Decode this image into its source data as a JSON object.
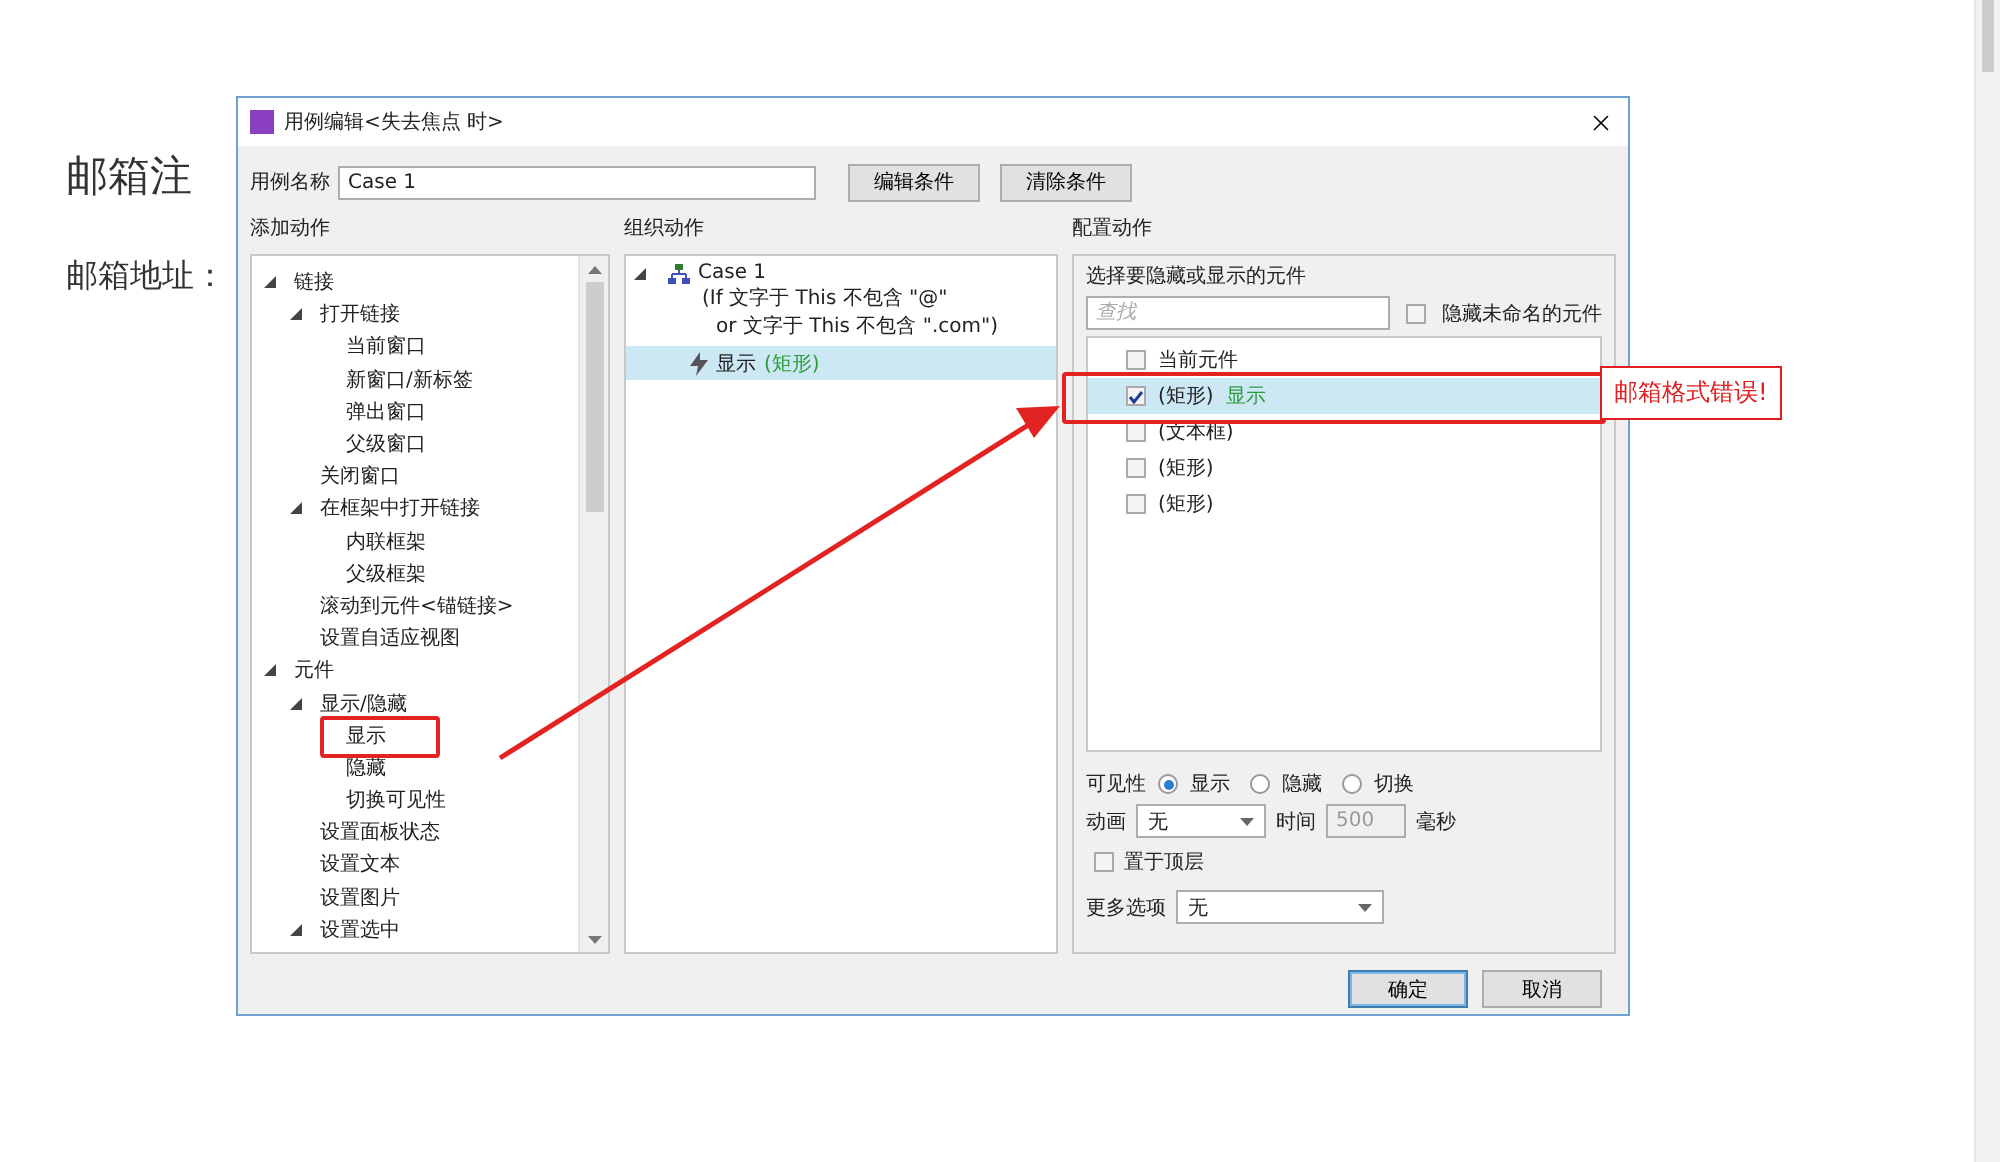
{
  "page": {
    "title": "邮箱注",
    "field_label": "邮箱地址："
  },
  "dialog": {
    "title": "用例编辑<失去焦点 时>",
    "case_name_label": "用例名称",
    "case_name": "Case 1",
    "condition_buttons": [
      "编辑条件",
      "清除条件"
    ],
    "add_actions": {
      "heading": "添加动作",
      "tree": [
        {
          "label": "链接",
          "expanded": true,
          "children": [
            {
              "label": "打开链接",
              "expanded": true,
              "children": [
                {
                  "label": "当前窗口"
                },
                {
                  "label": "新窗口/新标签"
                },
                {
                  "label": "弹出窗口"
                },
                {
                  "label": "父级窗口"
                }
              ]
            },
            {
              "label": "关闭窗口"
            },
            {
              "label": "在框架中打开链接",
              "expanded": true,
              "children": [
                {
                  "label": "内联框架"
                },
                {
                  "label": "父级框架"
                }
              ]
            },
            {
              "label": "滚动到元件<锚链接>"
            },
            {
              "label": "设置自适应视图"
            }
          ]
        },
        {
          "label": "元件",
          "expanded": true,
          "children": [
            {
              "label": "显示/隐藏",
              "expanded": true,
              "children": [
                {
                  "label": "显示"
                },
                {
                  "label": "隐藏"
                },
                {
                  "label": "切换可见性"
                }
              ]
            },
            {
              "label": "设置面板状态"
            },
            {
              "label": "设置文本"
            },
            {
              "label": "设置图片"
            },
            {
              "label": "设置选中",
              "expanded": true
            }
          ]
        }
      ]
    },
    "organize": {
      "heading": "组织动作",
      "case": {
        "name": "Case 1",
        "expanded": true,
        "condition_lines": [
          "(If 文字于 This 不包含 \"@\"",
          "or 文字于 This 不包含 \".com\")"
        ]
      },
      "actions": [
        {
          "verb": "显示",
          "target": "(矩形)",
          "selected": true
        }
      ]
    },
    "configure": {
      "heading": "配置动作",
      "group_label": "选择要隐藏或显示的元件",
      "search": {
        "placeholder": "查找"
      },
      "hide_unnamed": {
        "label": "隐藏未命名的元件",
        "checked": false
      },
      "widgets": [
        {
          "label": "当前元件",
          "checked": false,
          "selected": false
        },
        {
          "label": "(矩形)",
          "note": "显示",
          "checked": true,
          "selected": true
        },
        {
          "label": "(文本框)",
          "checked": false,
          "selected": false
        },
        {
          "label": "(矩形)",
          "checked": false,
          "selected": false
        },
        {
          "label": "(矩形)",
          "checked": false,
          "selected": false
        }
      ],
      "visibility": {
        "label": "可见性",
        "options": [
          {
            "label": "显示",
            "selected": true
          },
          {
            "label": "隐藏",
            "selected": false
          },
          {
            "label": "切换",
            "selected": false
          }
        ]
      },
      "animation": {
        "label": "动画",
        "value": "无",
        "time_label": "时间",
        "time_value": "500",
        "unit": "毫秒"
      },
      "bring_to_front": {
        "label": "置于顶层",
        "checked": false
      },
      "more": {
        "label": "更多选项",
        "value": "无"
      }
    },
    "footer_buttons": [
      {
        "label": "确定",
        "kind": "primary"
      },
      {
        "label": "取消",
        "kind": "normal"
      }
    ]
  },
  "error_tip": "邮箱格式错误!"
}
